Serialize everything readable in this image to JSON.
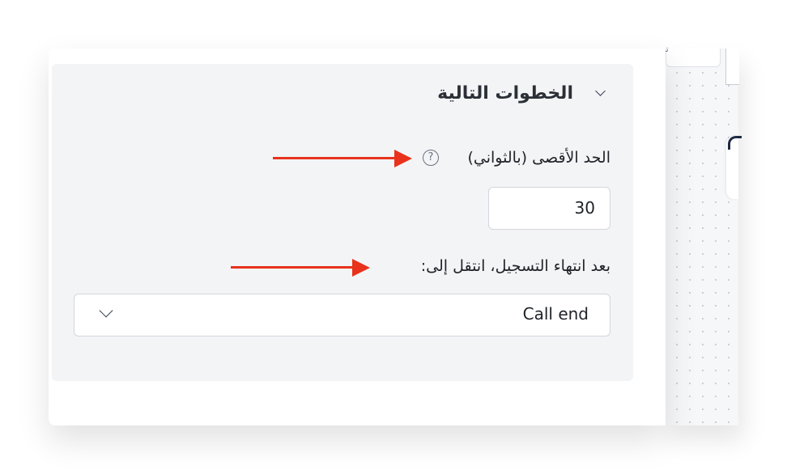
{
  "canvas": {
    "card_text": "تـ"
  },
  "panel": {
    "section_title": "الخطوات التالية",
    "max_duration": {
      "label": "الحد الأقصى (بالثواني)",
      "help_icon_glyph": "?",
      "value": "30"
    },
    "after_recording": {
      "label": "بعد انتهاء التسجيل، انتقل إلى:",
      "selected_value": "Call end"
    }
  },
  "annotations": {
    "arrow_color": "#e8321c"
  },
  "colors": {
    "section_background": "#f3f4f6",
    "text": "#1f2328",
    "input_border": "#d3d6dd"
  }
}
